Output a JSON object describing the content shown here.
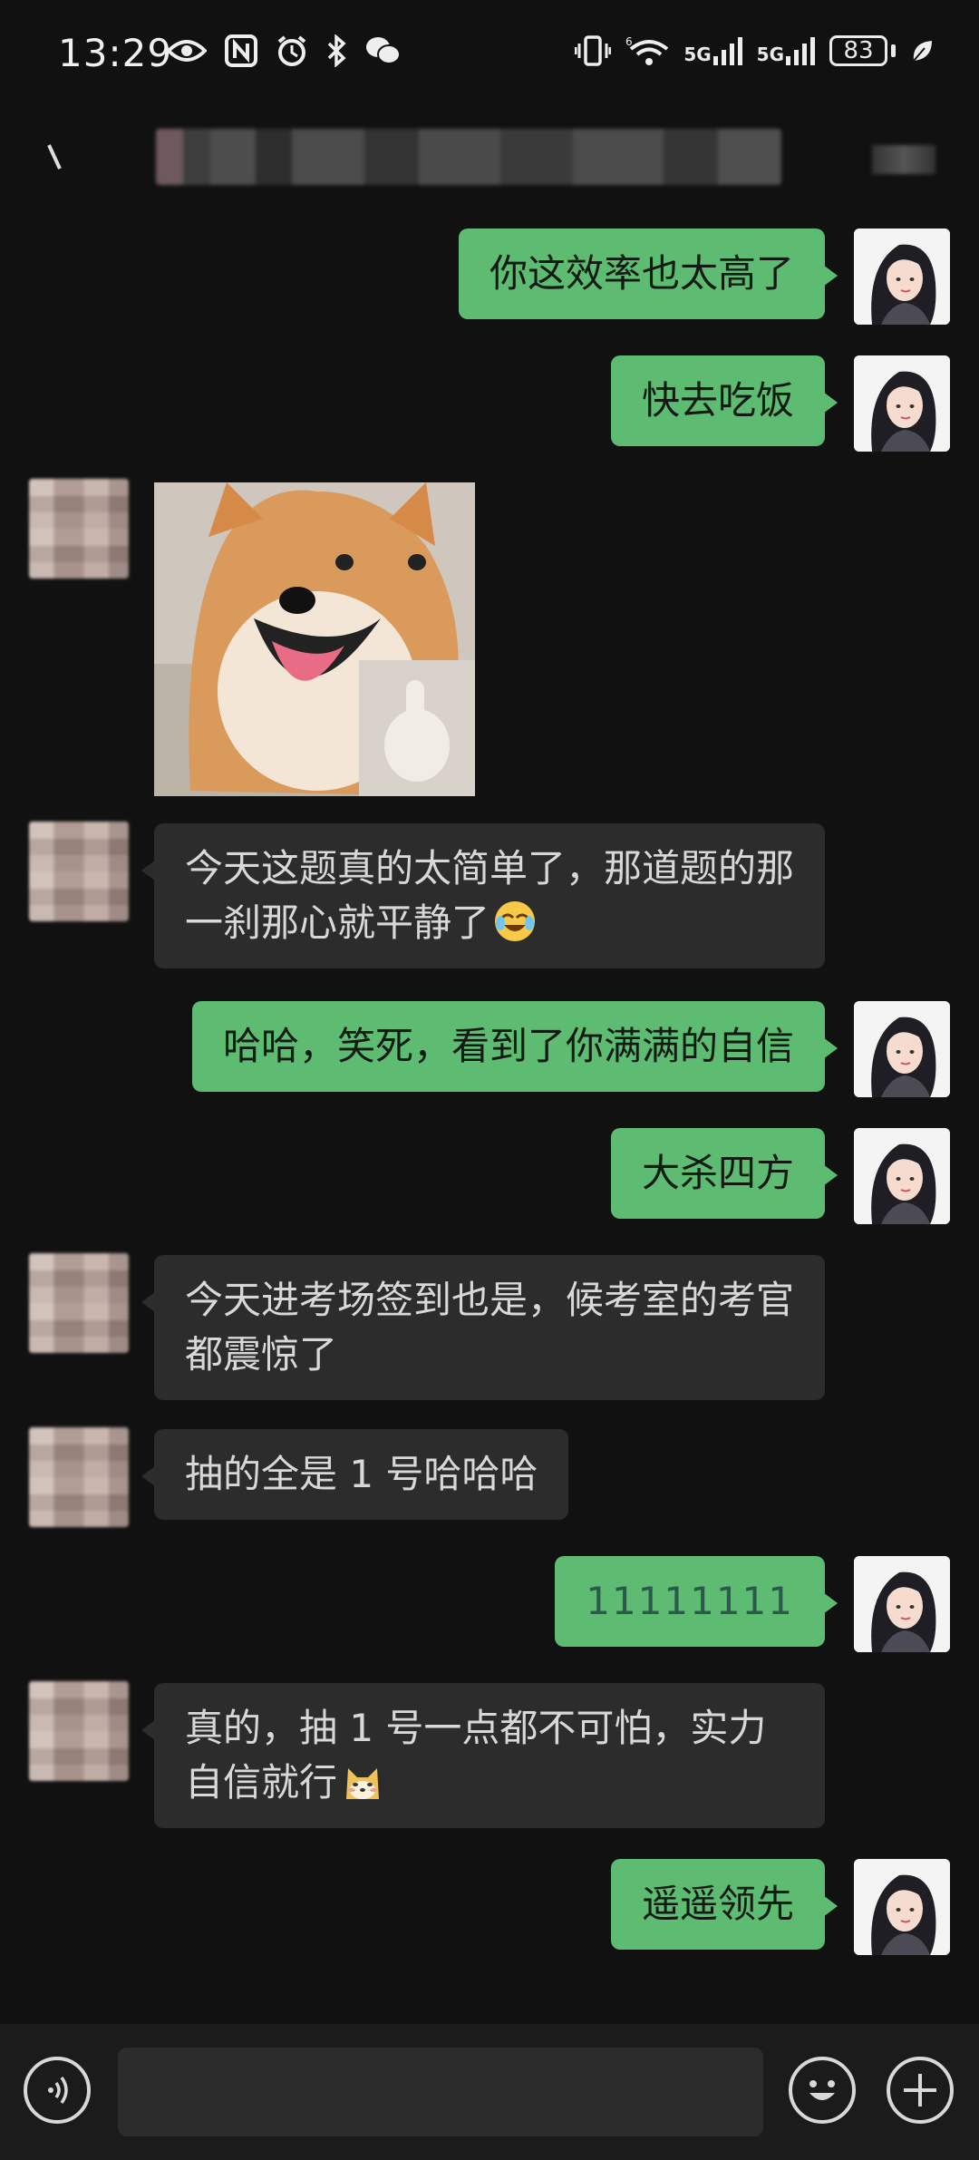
{
  "status_bar": {
    "time": "13:29",
    "battery": "83",
    "network_1": "5G",
    "network_2": "5G",
    "wifi_sup": "6"
  },
  "chat_header": {
    "back_icon": "back-icon"
  },
  "messages": [
    {
      "side": "right",
      "type": "text",
      "text": "你这效率也太高了"
    },
    {
      "side": "right",
      "type": "text",
      "text": "快去吃饭"
    },
    {
      "side": "left",
      "type": "sticker",
      "sticker": "shiba-thumbs-up"
    },
    {
      "side": "left",
      "type": "text",
      "text": "今天这题真的太简单了，那道题的那一刹那心就平静了",
      "emoji": "crying-laughing"
    },
    {
      "side": "right",
      "type": "text",
      "text": "哈哈，笑死，看到了你满满的自信"
    },
    {
      "side": "right",
      "type": "text",
      "text": "大杀四方"
    },
    {
      "side": "left",
      "type": "text",
      "text": "今天进考场签到也是，候考室的考官都震惊了"
    },
    {
      "side": "left",
      "type": "text",
      "text": "抽的全是 1 号哈哈哈"
    },
    {
      "side": "right",
      "type": "text",
      "text": "11111111"
    },
    {
      "side": "left",
      "type": "text",
      "text": "真的，抽 1 号一点都不可怕，实力自信就行",
      "emoji": "doge"
    },
    {
      "side": "right",
      "type": "text",
      "text": "遥遥领先"
    }
  ],
  "input_bar": {
    "voice_icon": "voice-icon",
    "emoji_icon": "emoji-icon",
    "plus_icon": "plus-icon",
    "input_value": ""
  }
}
